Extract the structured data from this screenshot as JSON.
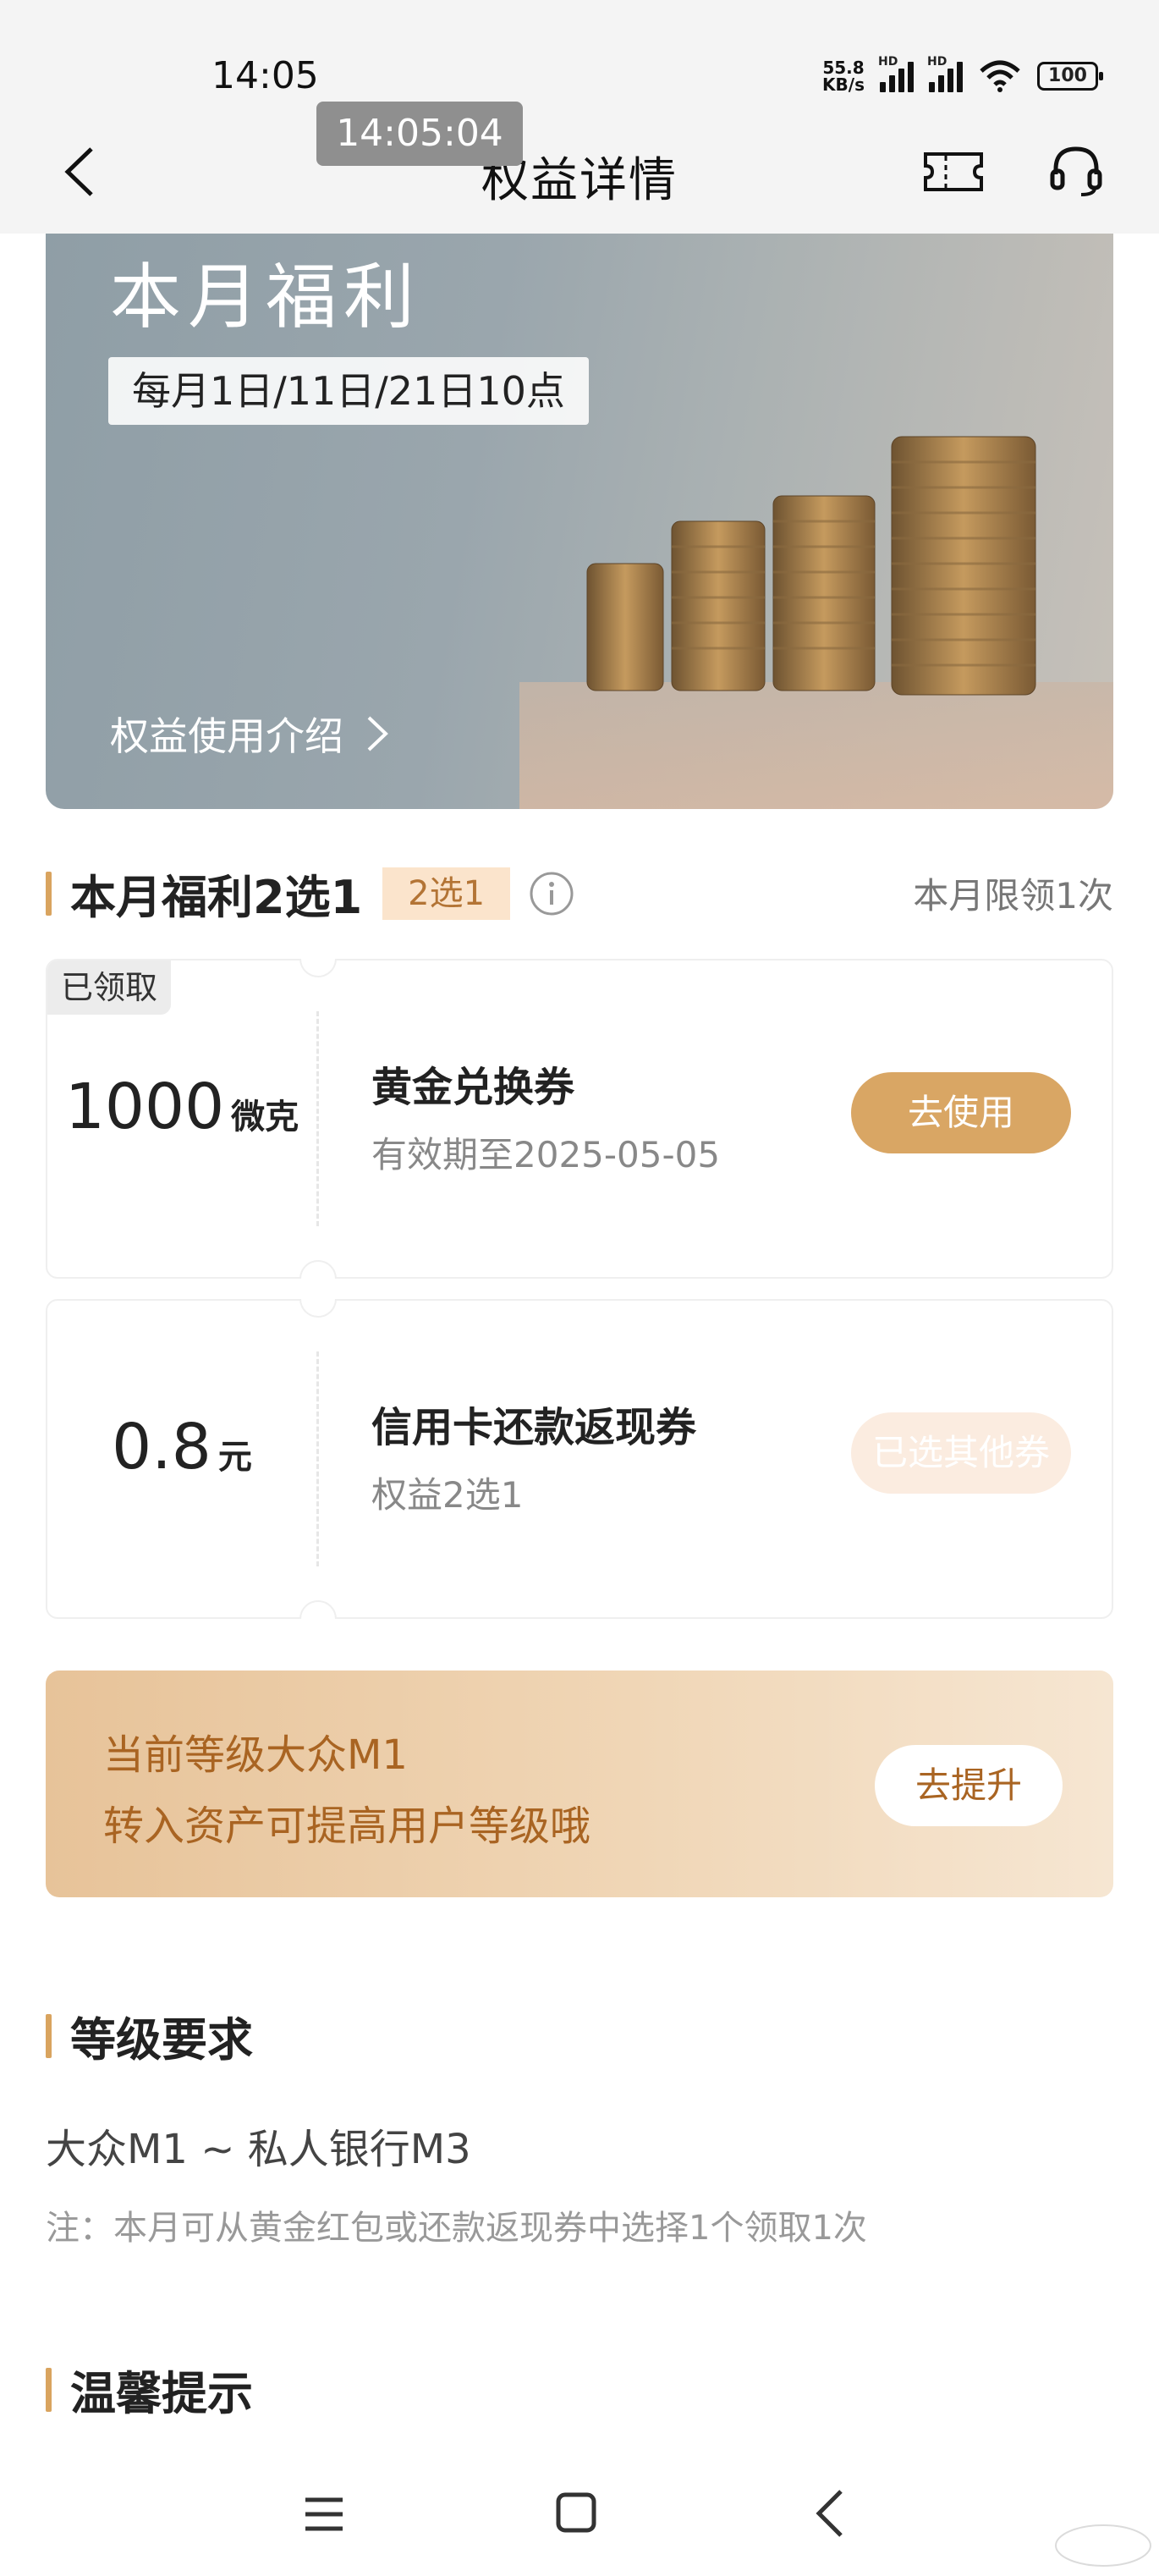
{
  "status_bar": {
    "time": "14:05",
    "net_speed_value": "55.8",
    "net_speed_unit": "KB/s",
    "sim_label": "HD",
    "battery": "100"
  },
  "time_toast": "14:05:04",
  "nav": {
    "title": "权益详情",
    "back_icon": "chevron-left-icon",
    "ticket_icon": "ticket-icon",
    "service_icon": "headset-icon"
  },
  "banner": {
    "title": "本月福利",
    "schedule": "每月1日/11日/21日10点",
    "intro_link": "权益使用介绍"
  },
  "benefit_section": {
    "title": "本月福利2选1",
    "tag": "2选1",
    "limit_note": "本月限领1次"
  },
  "coupons": [
    {
      "badge": "已领取",
      "amount": "1000",
      "unit": "微克",
      "title": "黄金兑换券",
      "subtitle": "有效期至2025-05-05",
      "action": "去使用"
    },
    {
      "badge": "",
      "amount": "0.8",
      "unit": "元",
      "title": "信用卡还款返现券",
      "subtitle": "权益2选1",
      "action": "已选其他券"
    }
  ],
  "upgrade": {
    "line1": "当前等级大众M1",
    "line2": "转入资产可提高用户等级哦",
    "button": "去提升"
  },
  "level_section": {
    "title": "等级要求",
    "range": "大众M1 ~ 私人银行M3",
    "note": "注：本月可从黄金红包或还款返现券中选择1个领取1次"
  },
  "tips_section": {
    "title": "温馨提示"
  },
  "colors": {
    "accent": "#d9a664",
    "accent_dark": "#a96422",
    "tag_bg": "#fbe4cc"
  }
}
